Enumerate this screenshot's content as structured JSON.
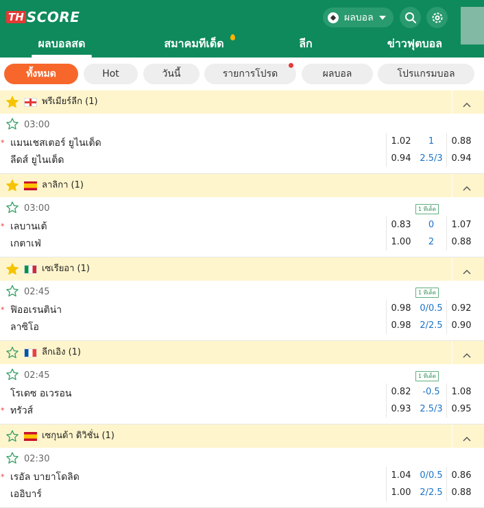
{
  "logo": {
    "th": "TH",
    "score": "SCORE"
  },
  "header": {
    "sport_selector": "ผลบอล",
    "search_icon": "search-icon",
    "settings_icon": "gear-icon"
  },
  "nav": [
    "ผลบอลสด",
    "สมาคมทีเด็ด",
    "ลีก",
    "ข่าวฟุตบอล"
  ],
  "filters": [
    "ทั้งหมด",
    "Hot",
    "วันนี้",
    "รายการโปรด",
    "ผลบอล",
    "โปรแกรมบอล"
  ],
  "colors": {
    "brand": "#0e8a5c",
    "accent": "#f7672c",
    "league_bg": "#fff5cc",
    "odds_blue": "#1a73c8"
  },
  "leagues": [
    {
      "name": "พรีเมียร์ลีก (1)",
      "flag": "england",
      "starred": true,
      "match": {
        "time": "03:00",
        "badge": "",
        "home": "แมนเชสเตอร์ ยูไนเต็ด",
        "away": "ลีดส์ ยูไนเต็ด",
        "home_red": true,
        "away_red": false,
        "odds": [
          [
            "1.02",
            "1",
            "0.88"
          ],
          [
            "0.94",
            "2.5/3",
            "0.94"
          ]
        ]
      }
    },
    {
      "name": "ลาลิกา (1)",
      "flag": "spain",
      "starred": true,
      "match": {
        "time": "03:00",
        "badge": "1 ทีเด็ด",
        "home": "เลบานเต้",
        "away": "เกตาเฟ่",
        "home_red": true,
        "away_red": false,
        "odds": [
          [
            "0.83",
            "0",
            "1.07"
          ],
          [
            "1.00",
            "2",
            "0.88"
          ]
        ]
      }
    },
    {
      "name": "เซเรียอา (1)",
      "flag": "italy",
      "starred": true,
      "match": {
        "time": "02:45",
        "badge": "1 ทีเด็ด",
        "home": "ฟิออเรนติน่า",
        "away": "ลาซิโอ",
        "home_red": true,
        "away_red": false,
        "odds": [
          [
            "0.98",
            "0/0.5",
            "0.92"
          ],
          [
            "0.98",
            "2/2.5",
            "0.90"
          ]
        ]
      }
    },
    {
      "name": "ลีกเอิง (1)",
      "flag": "france",
      "starred": false,
      "match": {
        "time": "02:45",
        "badge": "1 ทีเด็ด",
        "home": "โรเดซ อเวรอน",
        "away": "ทรัวส์",
        "home_red": false,
        "away_red": true,
        "odds": [
          [
            "0.82",
            "-0.5",
            "1.08"
          ],
          [
            "0.93",
            "2.5/3",
            "0.95"
          ]
        ]
      }
    },
    {
      "name": "เซกุนด้า ดิวิชั่น (1)",
      "flag": "spain",
      "starred": false,
      "match": {
        "time": "02:30",
        "badge": "",
        "home": "เรอัล บายาโดลิด",
        "away": "เออิบาร์",
        "home_red": true,
        "away_red": false,
        "odds": [
          [
            "1.04",
            "0/0.5",
            "0.86"
          ],
          [
            "1.00",
            "2/2.5",
            "0.88"
          ]
        ]
      }
    }
  ]
}
